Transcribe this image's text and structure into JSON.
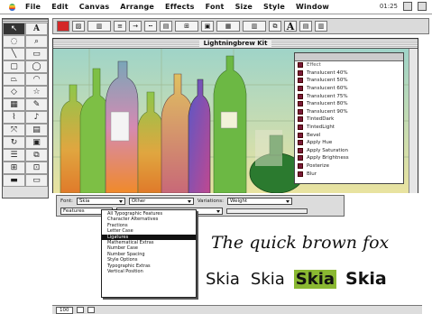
{
  "menubar": {
    "items": [
      "File",
      "Edit",
      "Canvas",
      "Arrange",
      "Effects",
      "Font",
      "Size",
      "Style",
      "Window"
    ],
    "clock": "01:25"
  },
  "document": {
    "title": "Lightningbrew Kit"
  },
  "effects_panel": {
    "items": [
      "Effect",
      "Translucent 40%",
      "Translucent 50%",
      "Translucent 60%",
      "Translucent 75%",
      "Translucent 80%",
      "Translucent 90%",
      "TintedDark",
      "TintedLight",
      "Bevel",
      "Apply Hue",
      "Apply Saturation",
      "Apply Brightness",
      "Posterize",
      "Blur"
    ],
    "swatch_color": "#7a1a3a"
  },
  "text_palette": {
    "font_label": "Font:",
    "font_value": "Skia",
    "style_value": "Other",
    "variations_label": "Variations:",
    "variations_value": "Weight",
    "features_value": "Features"
  },
  "features_menu": {
    "items": [
      "All Typographic Features",
      "Character Alternatives",
      "Fractions",
      "Letter Case",
      "Ligatures",
      "Mathematical Extras",
      "Number Case",
      "Number Spacing",
      "Style Options",
      "Typographic Extras",
      "Vertical Position"
    ],
    "selected": "Ligatures"
  },
  "sample": {
    "line1": "The quick brown fox",
    "skia_words": [
      "Skia",
      "Skia",
      "Skia",
      "Skia"
    ],
    "highlight_color": "#8ab832"
  },
  "bottom": {
    "zoom": "100"
  }
}
